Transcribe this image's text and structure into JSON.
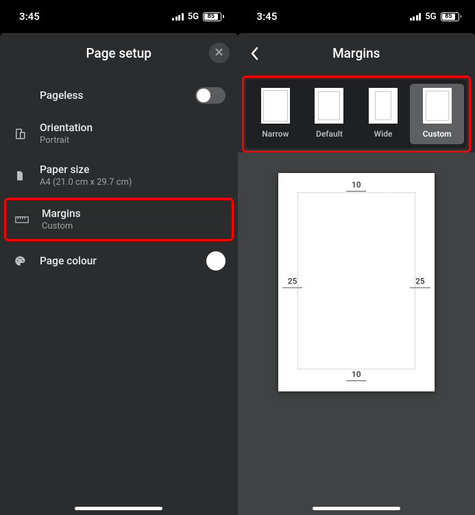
{
  "status": {
    "time": "3:45",
    "net": "5G",
    "battery": "85"
  },
  "left": {
    "title": "Page setup",
    "pageless_label": "Pageless",
    "orientation": {
      "label": "Orientation",
      "value": "Portrait"
    },
    "paper": {
      "label": "Paper size",
      "value": "A4 (21.0 cm x 29.7 cm)"
    },
    "margins": {
      "label": "Margins",
      "value": "Custom"
    },
    "colour_label": "Page colour",
    "colour_value": "#ffffff"
  },
  "right": {
    "title": "Margins",
    "options": [
      {
        "id": "narrow",
        "label": "Narrow"
      },
      {
        "id": "default",
        "label": "Default"
      },
      {
        "id": "wide",
        "label": "Wide"
      },
      {
        "id": "custom",
        "label": "Custom"
      }
    ],
    "selected": "custom",
    "preview": {
      "top": "10",
      "bottom": "10",
      "left": "25",
      "right": "25"
    }
  }
}
